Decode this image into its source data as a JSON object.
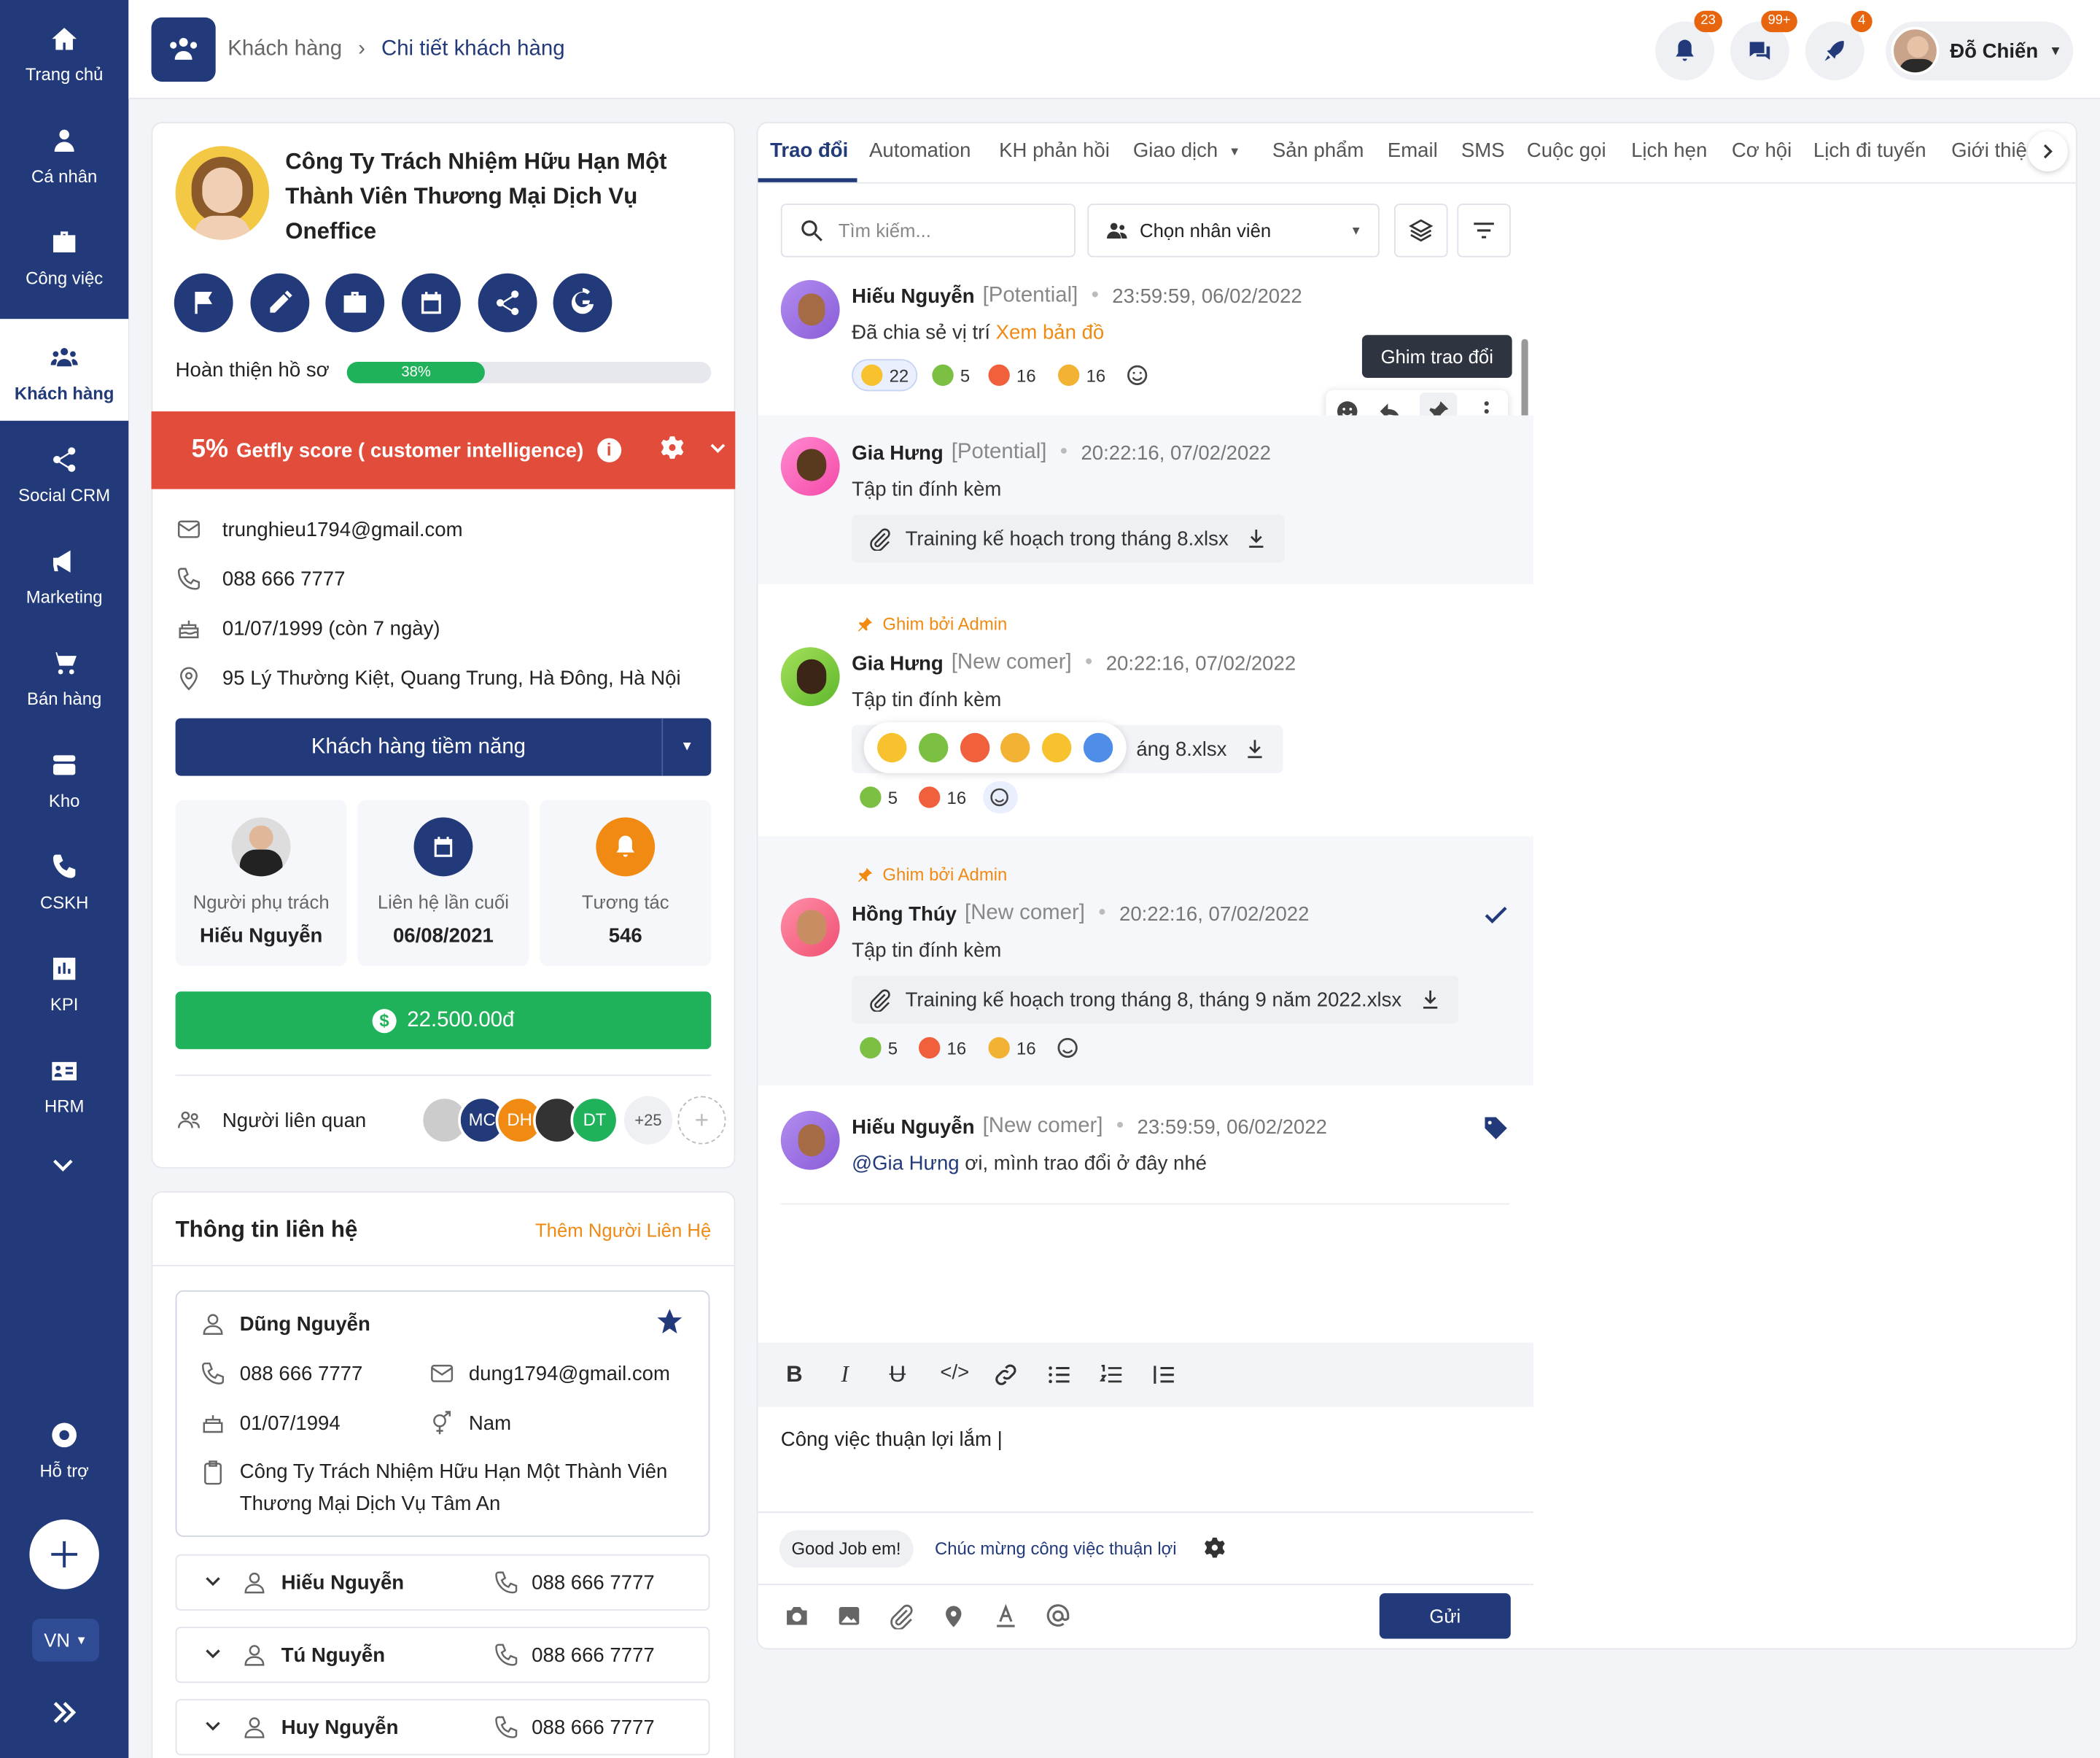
{
  "sidebar": {
    "items": [
      {
        "label": "Trang chủ",
        "icon": "home-icon"
      },
      {
        "label": "Cá nhân",
        "icon": "user-icon"
      },
      {
        "label": "Công việc",
        "icon": "briefcase-icon"
      },
      {
        "label": "Khách hàng",
        "icon": "customers-icon",
        "active": true
      },
      {
        "label": "Social CRM",
        "icon": "share-icon"
      },
      {
        "label": "Marketing",
        "icon": "megaphone-icon"
      },
      {
        "label": "Bán hàng",
        "icon": "cart-icon"
      },
      {
        "label": "Kho",
        "icon": "warehouse-icon"
      },
      {
        "label": "CSKH",
        "icon": "phone-icon"
      },
      {
        "label": "KPI",
        "icon": "chart-icon"
      },
      {
        "label": "HRM",
        "icon": "id-card-icon"
      }
    ],
    "support_label": "Hỗ trợ",
    "lang": "VN"
  },
  "header": {
    "breadcrumb_root": "Khách hàng",
    "breadcrumb_current": "Chi tiết khách hàng",
    "notif_count": "23",
    "chat_count": "99+",
    "rocket_count": "4",
    "user_name": "Đỗ Chiến"
  },
  "profile": {
    "company": "Công Ty Trách Nhiệm Hữu Hạn Một Thành Viên Thương Mại Dịch Vụ Oneffice",
    "completion_label": "Hoàn thiện hồ sơ",
    "completion_pct": "38%",
    "completion_value": 0.38,
    "score_pct": "5%",
    "score_label": "Getfly score ( customer intelligence)",
    "email": "trunghieu1794@gmail.com",
    "phone": "088 666 7777",
    "birthday": "01/07/1999 (còn 7 ngày)",
    "address": "95 Lý Thường Kiệt, Quang Trung, Hà Đông, Hà Nội",
    "status_button": "Khách hàng tiềm năng",
    "stats": [
      {
        "label": "Người phụ trách",
        "value": "Hiếu Nguyễn"
      },
      {
        "label": "Liên hệ lần cuối",
        "value": "06/08/2021"
      },
      {
        "label": "Tương tác",
        "value": "546"
      }
    ],
    "revenue": "22.500.00đ",
    "related_label": "Người liên quan",
    "related_avatars": [
      "MC",
      "DH",
      "DT"
    ],
    "related_more": "+25"
  },
  "contacts": {
    "title": "Thông tin liên hệ",
    "add_label": "Thêm Người Liên Hệ",
    "main": {
      "name": "Dũng Nguyễn",
      "phone": "088 666 7777",
      "email": "dung1794@gmail.com",
      "birthday": "01/07/1994",
      "gender": "Nam",
      "company": "Công Ty Trách Nhiệm Hữu Hạn Một Thành Viên Thương Mại Dịch Vụ Tâm An"
    },
    "rows": [
      {
        "name": "Hiếu Nguyễn",
        "phone": "088 666 7777"
      },
      {
        "name": "Tú Nguyễn",
        "phone": "088 666 7777"
      },
      {
        "name": "Huy Nguyễn",
        "phone": "088 666 7777"
      }
    ]
  },
  "tabs": [
    "Trao đổi",
    "Automation",
    "KH phản hồi",
    "Giao dịch",
    "Sản phẩm",
    "Email",
    "SMS",
    "Cuộc gọi",
    "Lịch hẹn",
    "Cơ hội",
    "Lịch đi tuyến",
    "Giới thiệ"
  ],
  "filters": {
    "search_placeholder": "Tìm kiếm...",
    "staff_select": "Chọn nhân viên"
  },
  "tooltip": "Ghim trao đổi",
  "messages": [
    {
      "name": "Hiếu Nguyễn",
      "tag": "[Potential]",
      "time": "23:59:59, 06/02/2022",
      "text": "Đã chia sẻ vị trí",
      "link": "Xem bản đồ",
      "reactions": [
        "22",
        "5",
        "16",
        "16"
      ]
    },
    {
      "name": "Gia Hưng",
      "tag": "[Potential]",
      "time": "20:22:16, 07/02/2022",
      "text": "Tập tin đính kèm",
      "file": "Training kế hoạch trong tháng 8.xlsx"
    },
    {
      "pin": "Ghim bởi Admin",
      "name": "Gia Hưng",
      "tag": "[New comer]",
      "time": "20:22:16, 07/02/2022",
      "text": "Tập tin đính kèm",
      "file": "áng 8.xlsx",
      "reactions": [
        "5",
        "16"
      ]
    },
    {
      "pin": "Ghim bởi Admin",
      "name": "Hồng Thúy",
      "tag": "[New comer]",
      "time": "20:22:16, 07/02/2022",
      "text": "Tập tin đính kèm",
      "file": "Training kế hoạch trong tháng 8, tháng 9 năm 2022.xlsx",
      "reactions": [
        "5",
        "16",
        "16"
      ]
    },
    {
      "name": "Hiếu Nguyễn",
      "tag": "[New comer]",
      "time": "23:59:59, 06/02/2022",
      "mention": "@Gia Hưng",
      "text": " ơi, mình trao đổi ở đây nhé"
    }
  ],
  "composer": {
    "text": "Công việc thuận lợi lắm |",
    "suggestions": [
      "Good Job em!",
      "Chúc mừng công việc thuận lợi"
    ],
    "send": "Gửi"
  },
  "colors": {
    "primary": "#223a7a",
    "accent": "#f08a12",
    "danger": "#e24c3b",
    "success": "#1fb25a"
  }
}
